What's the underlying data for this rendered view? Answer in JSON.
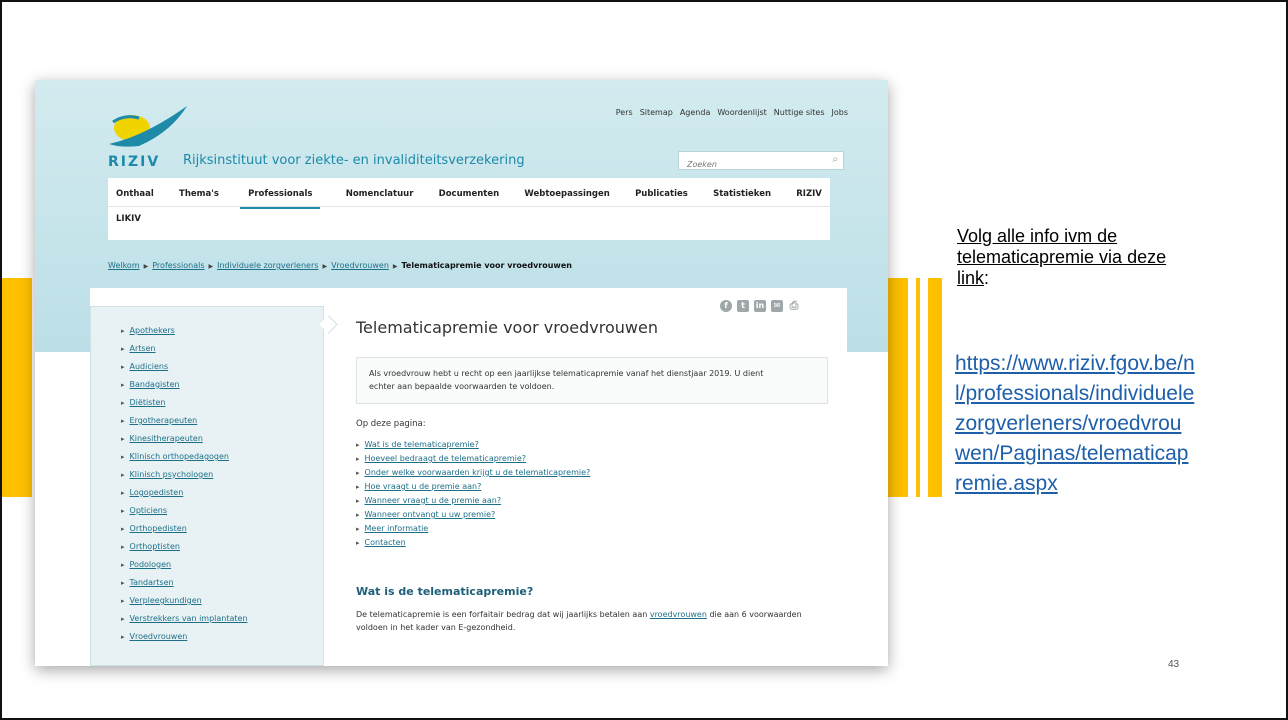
{
  "browser_shot": {
    "logo_text": "RIZIV",
    "tagline": "Rijksinstituut voor ziekte- en invaliditeitsverzekering",
    "top_links": [
      "Pers",
      "Sitemap",
      "Agenda",
      "Woordenlijst",
      "Nuttige sites",
      "Jobs"
    ],
    "search_placeholder": "Zoeken",
    "nav": [
      "Onthaal",
      "Thema's",
      "Professionals",
      "Nomenclatuur",
      "Documenten",
      "Webtoepassingen",
      "Publicaties",
      "Statistieken",
      "RIZIV"
    ],
    "nav_active": "Professionals",
    "nav_row2": "LIKIV",
    "breadcrumb": [
      "Welkom",
      "Professionals",
      "Individuele zorgverleners",
      "Vroedvrouwen"
    ],
    "breadcrumb_current": "Telematicapremie voor vroedvrouwen",
    "sidebar": [
      "Apothekers",
      "Artsen",
      "Audiciens",
      "Bandagisten",
      "Diëtisten",
      "Ergotherapeuten",
      "Kinesitherapeuten",
      "Klinisch orthopedagogen",
      "Klinisch psychologen",
      "Logopedisten",
      "Opticiens",
      "Orthopedisten",
      "Orthoptisten",
      "Podologen",
      "Tandartsen",
      "Verpleegkundigen",
      "Verstrekkers van implantaten",
      "Vroedvrouwen"
    ],
    "page_title": "Telematicapremie voor vroedvrouwen",
    "intro_line1": "Als vroedvrouw hebt u recht op een jaarlijkse telematicapremie vanaf het dienstjaar 2019.  U dient",
    "intro_line2": "echter aan bepaalde voorwaarden te voldoen.",
    "on_page_label": "Op deze pagina:",
    "toc": [
      "Wat is de telematicapremie?",
      "Hoeveel bedraagt de telematicapremie?",
      "Onder welke voorwaarden krijgt u de telematicapremie?",
      "Hoe vraagt u de premie aan?",
      "Wanneer vraagt u de premie aan?",
      "Wanneer ontvangt u uw premie?",
      "Meer informatie",
      "Contacten"
    ],
    "section_title": "Wat is de telematicapremie?",
    "section_text_a": "De telematicapremie is een forfaitair bedrag dat wij jaarlijks betalen aan ",
    "section_text_link": "vroedvrouwen",
    "section_text_b": " die aan 6 voorwaarden voldoen in het kader van E-gezondheid.",
    "share_icons": [
      "facebook-icon",
      "twitter-icon",
      "linkedin-icon",
      "email-icon",
      "print-icon"
    ]
  },
  "slide": {
    "note": "Volg alle info ivm de telematicapremie via deze link",
    "note_colon": ":",
    "url": "https://www.riziv.fgov.be/nl/professionals/individuelezorgverleners/vroedvrouwen/Paginas/telematicapremie.aspx",
    "page_number": "43"
  },
  "colors": {
    "accent_gold": "#ffc000",
    "riziv_teal": "#1d8aa8",
    "link_blue": "#1e5faa"
  }
}
